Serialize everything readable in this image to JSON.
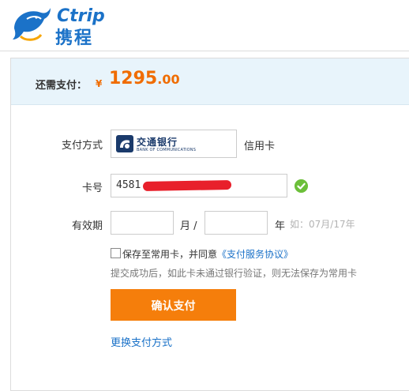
{
  "brand": {
    "name_en": "Ctrip",
    "name_cn": "携程",
    "color": "#1b72c8"
  },
  "summary": {
    "label": "还需支付：",
    "currency": "¥",
    "amount_int": "1295",
    "amount_dec": ".00",
    "accent": "#f06c00"
  },
  "payment_method": {
    "label": "支付方式",
    "bank_name_cn": "交通银行",
    "bank_name_en": "BANK OF COMMUNICATIONS",
    "card_type": "信用卡"
  },
  "card_number": {
    "label": "卡号",
    "value": "4581"
  },
  "expiry": {
    "label": "有效期",
    "month_unit": "月 /",
    "year_unit": "年",
    "hint": "如：07月/17年"
  },
  "agreement": {
    "text": "保存至常用卡，并同意",
    "link": "《支付服务协议》"
  },
  "note": "提交成功后，如此卡未通过银行验证，则无法保存为常用卡",
  "confirm_button": "确认支付",
  "change_method_link": "更换支付方式",
  "icons": {
    "logo": "dolphin-logo-icon",
    "valid": "check-circle-icon"
  }
}
